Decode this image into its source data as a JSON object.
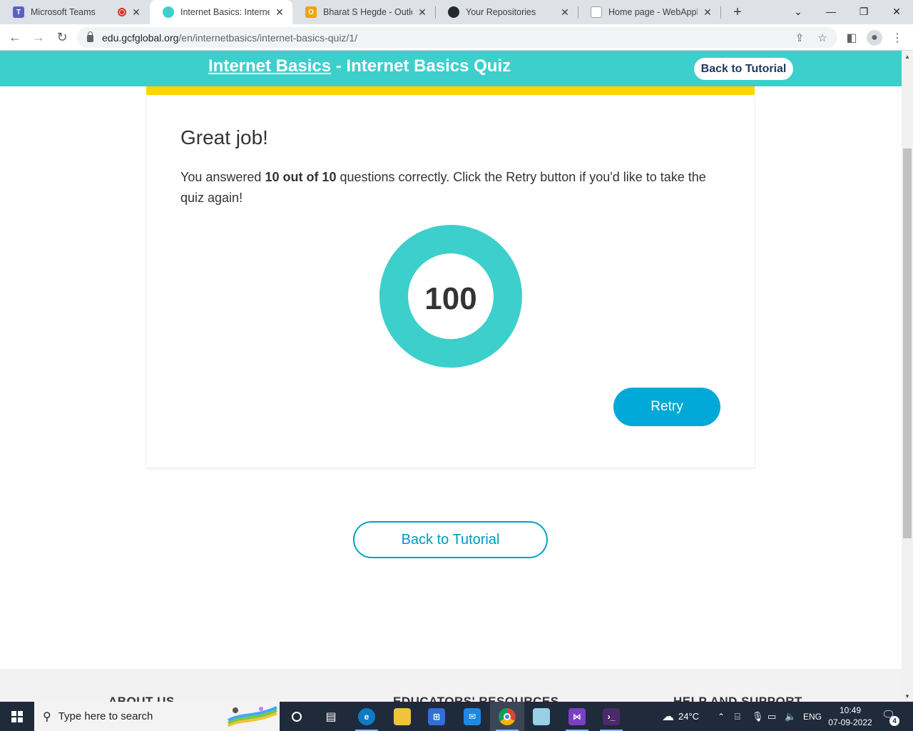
{
  "browser": {
    "tabs": [
      {
        "title": "Microsoft Teams",
        "icon": "teams-icon",
        "color": "#5b5fc7",
        "glyph": "T"
      },
      {
        "title": "Internet Basics: Internet B",
        "icon": "gcf-icon",
        "color": "#3dcfcb",
        "glyph": "●"
      },
      {
        "title": "Bharat S Hegde - Outlook",
        "icon": "outlook-icon",
        "color": "#f0a30a",
        "glyph": "O"
      },
      {
        "title": "Your Repositories",
        "icon": "github-icon",
        "color": "#24292f",
        "glyph": "◉"
      },
      {
        "title": "Home page - WebAppDE",
        "icon": "document-icon",
        "color": "#c8ccd0",
        "glyph": ""
      }
    ],
    "url_host": "edu.gcfglobal.org",
    "url_path": "/en/internetbasics/internet-basics-quiz/1/"
  },
  "header": {
    "course_link": "Internet Basics",
    "separator": " - ",
    "page_title": "Internet Basics Quiz",
    "back_button": "Back to Tutorial"
  },
  "result": {
    "heading": "Great job!",
    "text_before": "You answered ",
    "text_bold": "10 out of 10",
    "text_after": " questions correctly. Click the Retry button if you'd like to take the quiz again!",
    "score": "100",
    "score_fraction": 1.0,
    "retry_label": "Retry"
  },
  "bottom_back_button": "Back to Tutorial",
  "footer": {
    "headings": [
      "ABOUT US",
      "EDUCATORS' RESOURCES",
      "HELP AND SUPPORT"
    ]
  },
  "taskbar": {
    "search_placeholder": "Type here to search",
    "temperature": "24°C",
    "language": "ENG",
    "time": "10:49",
    "date": "07-09-2022",
    "notification_count": "4"
  },
  "colors": {
    "brand_teal": "#3dcfcb",
    "accent_yellow": "#ffd400",
    "retry_blue": "#00a9d7",
    "donut_teal": "#3dcfcb"
  }
}
